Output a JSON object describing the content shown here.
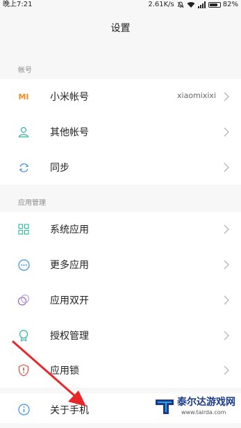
{
  "status_bar": {
    "time": "晚上7:21",
    "network_speed": "2.61K/s",
    "battery": "82%",
    "battery_level": 0.82,
    "icons": [
      "mute-icon",
      "wifi-icon",
      "signal-icon",
      "battery-icon"
    ]
  },
  "header": {
    "title": "设置"
  },
  "sections": [
    {
      "label": "帐号",
      "items": [
        {
          "label": "小米帐号",
          "value": "xiaomixixi",
          "icon": "mi-logo-icon",
          "icon_text": "MI"
        },
        {
          "label": "其他帐号",
          "icon": "user-icon"
        },
        {
          "label": "同步",
          "icon": "sync-icon"
        }
      ]
    },
    {
      "label": "应用管理",
      "items": [
        {
          "label": "系统应用",
          "icon": "grid-icon"
        },
        {
          "label": "更多应用",
          "icon": "more-dots-icon"
        },
        {
          "label": "应用双开",
          "icon": "dual-app-icon"
        },
        {
          "label": "授权管理",
          "icon": "permission-badge-icon"
        },
        {
          "label": "应用锁",
          "icon": "app-lock-shield-icon"
        }
      ]
    },
    {
      "items": [
        {
          "label": "关于手机",
          "icon": "info-icon"
        }
      ]
    }
  ],
  "watermark": {
    "title": "泰尔达游戏网",
    "url": "www.tairda.com"
  },
  "colors": {
    "background": "#f7f7f7",
    "row_background": "#ffffff",
    "mi_orange": "#f08a24",
    "teal": "#2fb59e",
    "blue": "#3a8ee6",
    "purple": "#8e6ad8",
    "red": "#e04b3c",
    "arrow_red": "#e8262a"
  }
}
